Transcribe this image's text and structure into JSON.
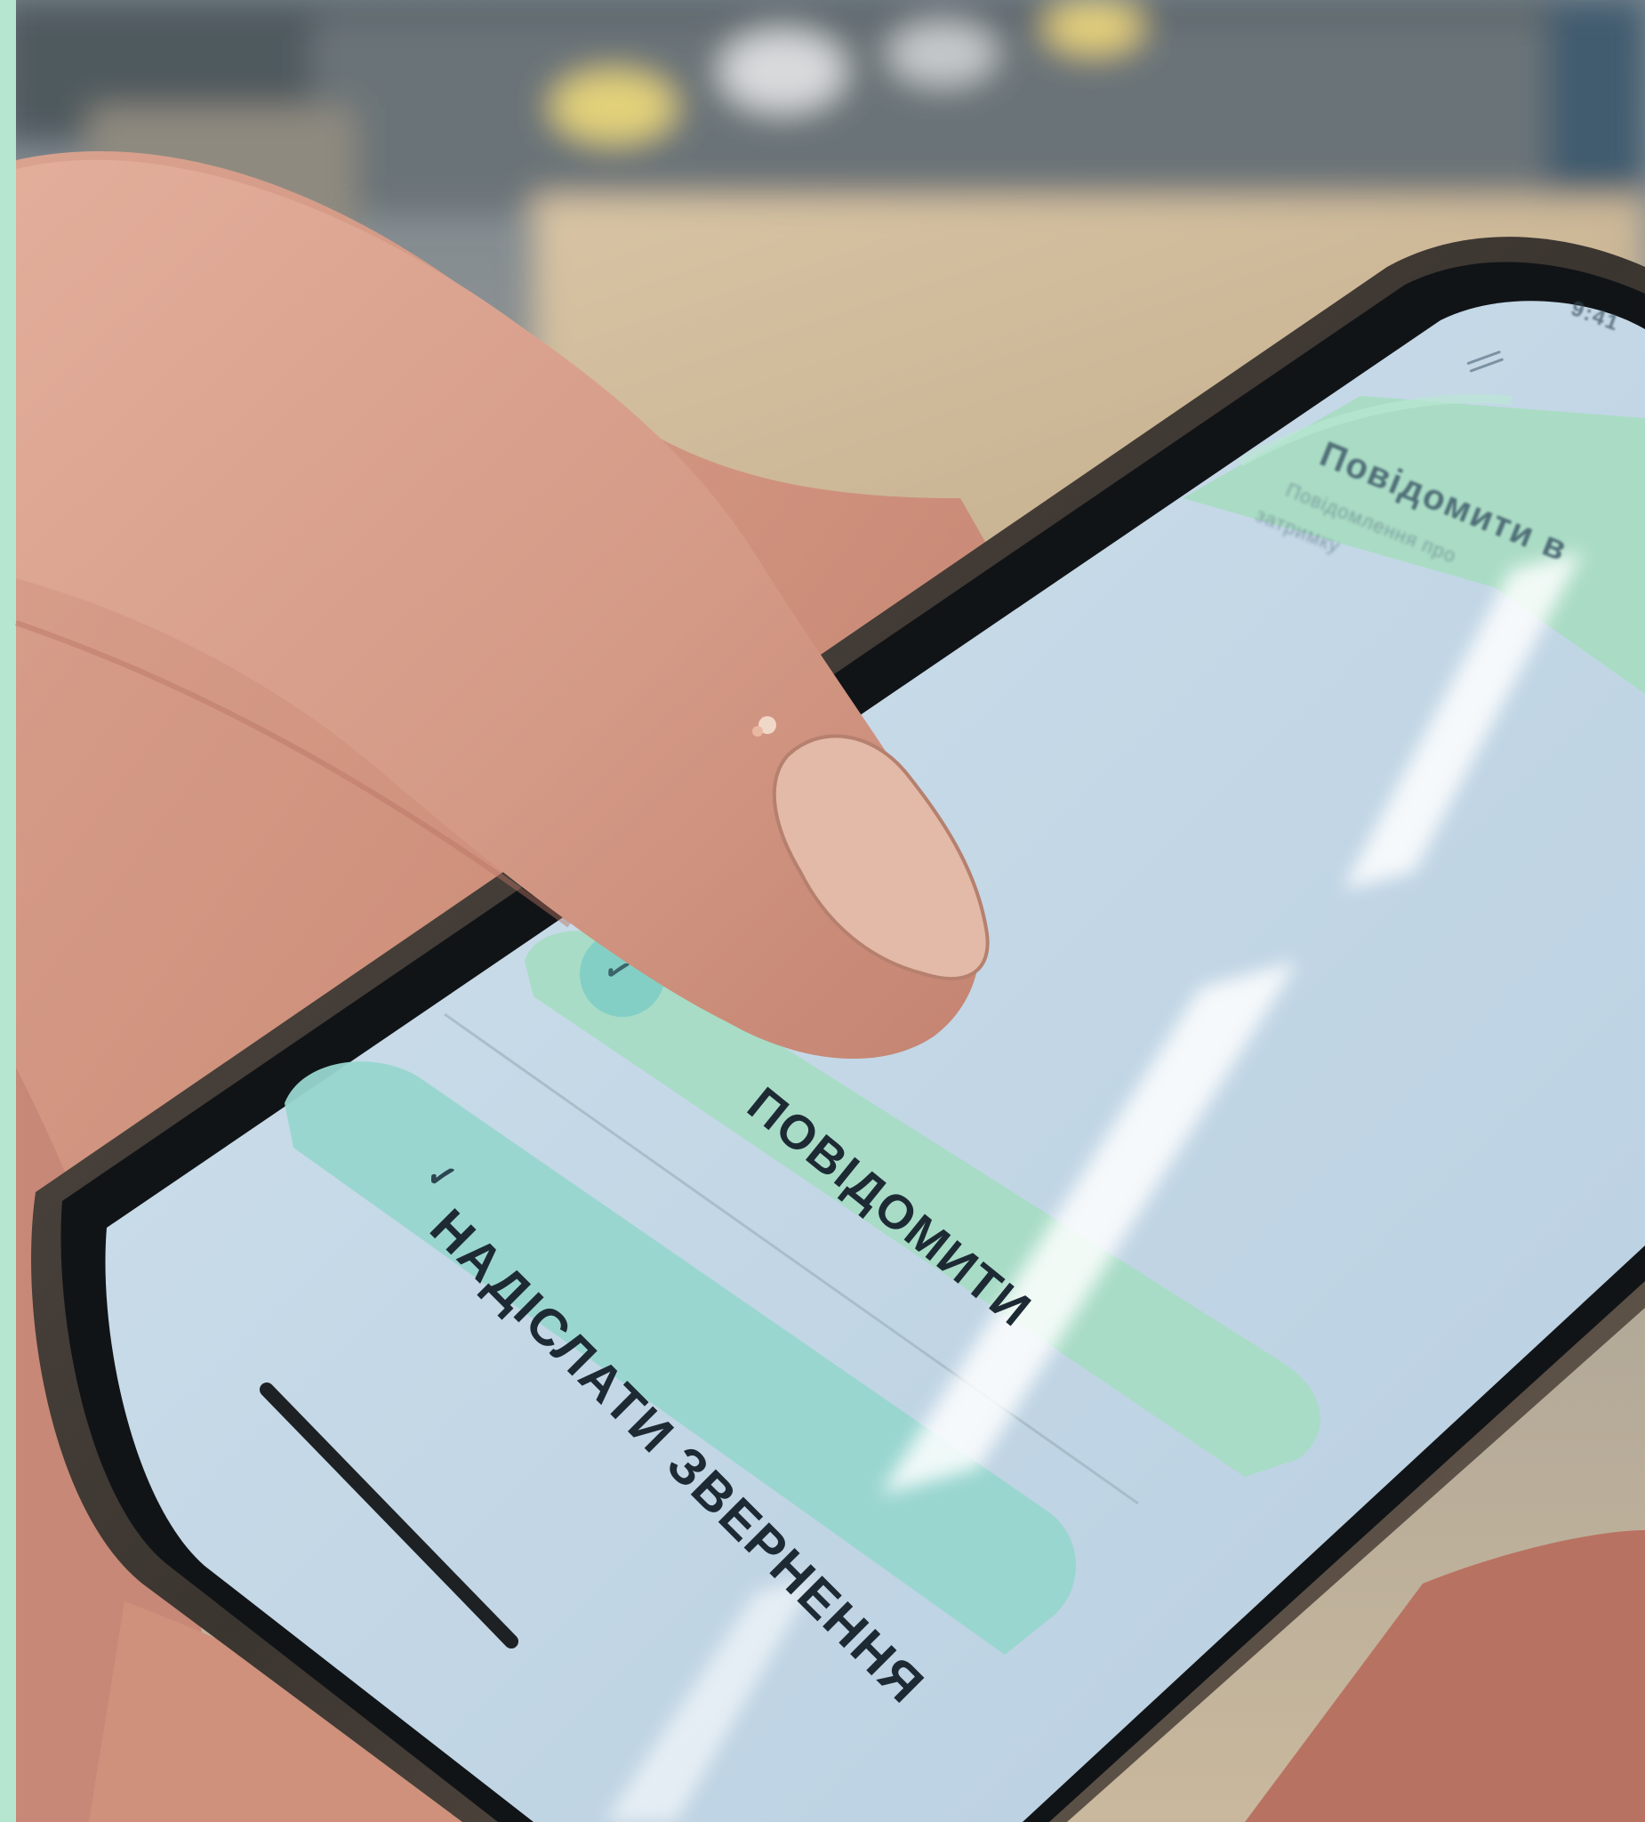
{
  "screen": {
    "top_card": {
      "title": "Повідомити в",
      "subtitle_line1": "Повідомлення про",
      "subtitle_line2": "затримку"
    },
    "button_report": {
      "label": "ПОВІДОМИТИ"
    },
    "button_send": {
      "label": "НАДІСЛАТИ ЗВЕРНЕННЯ"
    },
    "status_time": "9:41"
  },
  "icons": {
    "menu": "hamburger-menu-icon",
    "check": "checkmark-icon"
  },
  "colors": {
    "screen": "#c6d8e6",
    "card_mint": "#a8dcc6",
    "card_teal": "#98d6cf",
    "accent_bar": "#b8ecd6",
    "text": "#1d2a34"
  }
}
